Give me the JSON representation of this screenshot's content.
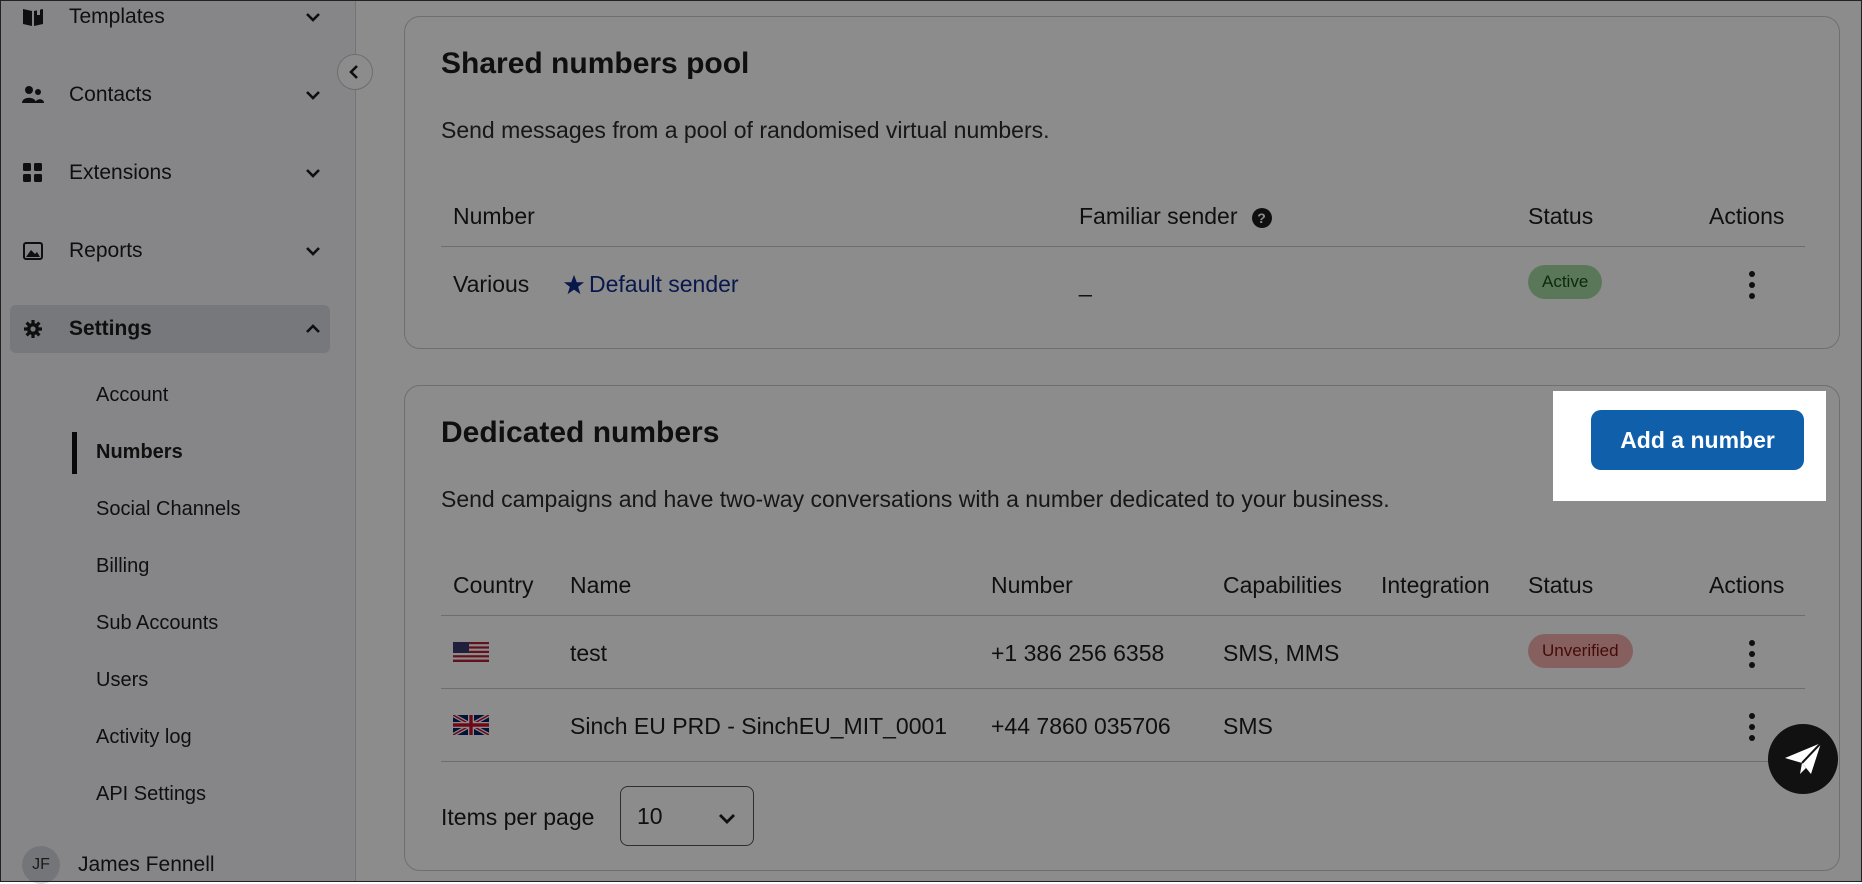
{
  "sidebar": {
    "nav": [
      {
        "label": "Templates",
        "icon": "book-icon"
      },
      {
        "label": "Contacts",
        "icon": "contacts-icon"
      },
      {
        "label": "Extensions",
        "icon": "grid-icon"
      },
      {
        "label": "Reports",
        "icon": "image-icon"
      },
      {
        "label": "Settings",
        "icon": "gear-icon"
      }
    ],
    "settings_items": [
      "Account",
      "Numbers",
      "Social Channels",
      "Billing",
      "Sub Accounts",
      "Users",
      "Activity log",
      "API Settings"
    ],
    "current_item": "Numbers",
    "user": {
      "initials": "JF",
      "name": "James Fennell"
    }
  },
  "shared": {
    "title": "Shared numbers pool",
    "description": "Send messages from a pool of randomised virtual numbers.",
    "headers": {
      "number": "Number",
      "familiar": "Familiar sender",
      "status": "Status",
      "actions": "Actions"
    },
    "row": {
      "number": "Various",
      "default_sender": "Default sender",
      "familiar": "_",
      "status": "Active"
    }
  },
  "dedicated": {
    "title": "Dedicated numbers",
    "add_button": "Add a number",
    "description": "Send campaigns and have two-way conversations with a number dedicated to your business.",
    "headers": {
      "country": "Country",
      "name": "Name",
      "number": "Number",
      "capabilities": "Capabilities",
      "integration": "Integration",
      "status": "Status",
      "actions": "Actions"
    },
    "rows": [
      {
        "flag": "us-flag-icon",
        "name": "test",
        "number": "+1 386 256 6358",
        "capabilities": "SMS, MMS",
        "integration": "",
        "status": "Unverified"
      },
      {
        "flag": "uk-flag-icon",
        "name": "Sinch EU PRD - SinchEU_MIT_0001",
        "number": "+44 7860 035706",
        "capabilities": "SMS",
        "integration": "",
        "status": ""
      }
    ],
    "items_per_page_label": "Items per page",
    "items_per_page_value": "10"
  },
  "colors": {
    "primary": "#0f5fab",
    "active_badge": "#a6d9a3",
    "unverified_badge": "#f4b0ab",
    "link": "#0f2d8c"
  }
}
